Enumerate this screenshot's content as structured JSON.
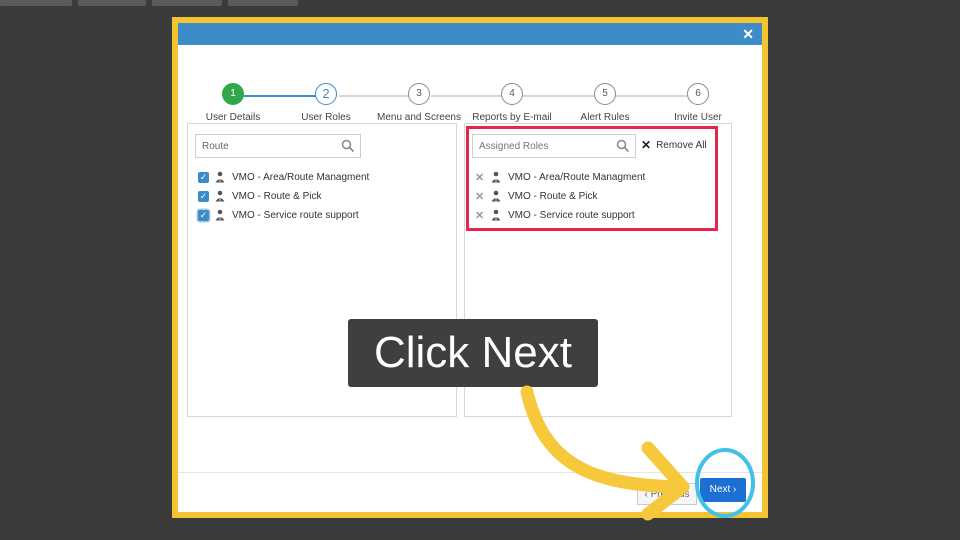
{
  "steps": [
    {
      "number": "1",
      "label": "User Details"
    },
    {
      "number": "2",
      "label": "User Roles"
    },
    {
      "number": "3",
      "label": "Menu and Screens"
    },
    {
      "number": "4",
      "label": "Reports by E-mail and SMS"
    },
    {
      "number": "5",
      "label": "Alert Rules"
    },
    {
      "number": "6",
      "label": "Invite User"
    }
  ],
  "left_panel": {
    "search_value": "Route",
    "roles": [
      "VMO - Area/Route Managment",
      "VMO - Route & Pick",
      "VMO - Service route support"
    ]
  },
  "right_panel": {
    "search_placeholder": "Assigned Roles",
    "remove_all_label": "Remove All",
    "roles": [
      "VMO - Area/Route Managment",
      "VMO - Route & Pick",
      "VMO - Service route support"
    ]
  },
  "footer": {
    "previous_label": "Previous",
    "next_label": "Next"
  },
  "overlay": {
    "callout_text": "Click Next"
  },
  "colors": {
    "frame": "#f4c430",
    "header": "#3d8bc7",
    "step_done": "#2ea84a",
    "highlight": "#e8244a",
    "next_button": "#1e6fd4",
    "ring": "#3fc1e8"
  }
}
